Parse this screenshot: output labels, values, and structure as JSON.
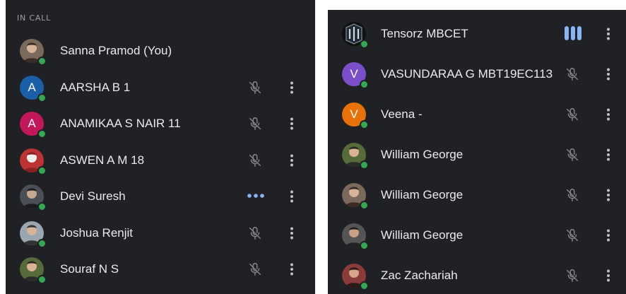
{
  "left_panel": {
    "section_label": "IN CALL",
    "participants": [
      {
        "name": "Sanna Pramod (You)",
        "avatar": "photo",
        "status": "none"
      },
      {
        "name": "AARSHA B 1",
        "avatar": "letter",
        "initial": "A",
        "avatar_color": "#1a5fa8",
        "status": "muted"
      },
      {
        "name": "ANAMIKAA S NAIR 11",
        "avatar": "letter",
        "initial": "A",
        "avatar_color": "#c2185b",
        "status": "muted"
      },
      {
        "name": "ASWEN A M 18",
        "avatar": "photo",
        "status": "muted"
      },
      {
        "name": "Devi Suresh",
        "avatar": "photo",
        "status": "speaking-dots"
      },
      {
        "name": "Joshua Renjit",
        "avatar": "photo",
        "status": "muted"
      },
      {
        "name": "Souraf N S",
        "avatar": "photo",
        "status": "muted"
      }
    ]
  },
  "right_panel": {
    "participants": [
      {
        "name": "Tensorz MBCET",
        "avatar": "logo",
        "status": "speaking-bars"
      },
      {
        "name": "VASUNDARAA G MBT19EC113",
        "avatar": "letter",
        "initial": "V",
        "avatar_color": "#7b4fc9",
        "status": "muted"
      },
      {
        "name": "Veena -",
        "avatar": "letter",
        "initial": "V",
        "avatar_color": "#e8710a",
        "status": "muted"
      },
      {
        "name": "William George",
        "avatar": "photo",
        "status": "muted"
      },
      {
        "name": "William George",
        "avatar": "photo",
        "status": "muted"
      },
      {
        "name": "William George",
        "avatar": "photo",
        "status": "muted"
      },
      {
        "name": "Zac Zachariah",
        "avatar": "photo",
        "status": "muted"
      }
    ]
  },
  "colors": {
    "panel_bg": "#202124",
    "text": "#e8eaed",
    "muted_icon": "#80868b",
    "accent_blue": "#8ab4f8",
    "online_green": "#34a853"
  },
  "icons": {
    "muted": "mic-off-icon",
    "more": "more-vert-icon",
    "speaking_dots": "speaking-dots-icon",
    "speaking_bars": "audio-bars-icon"
  }
}
